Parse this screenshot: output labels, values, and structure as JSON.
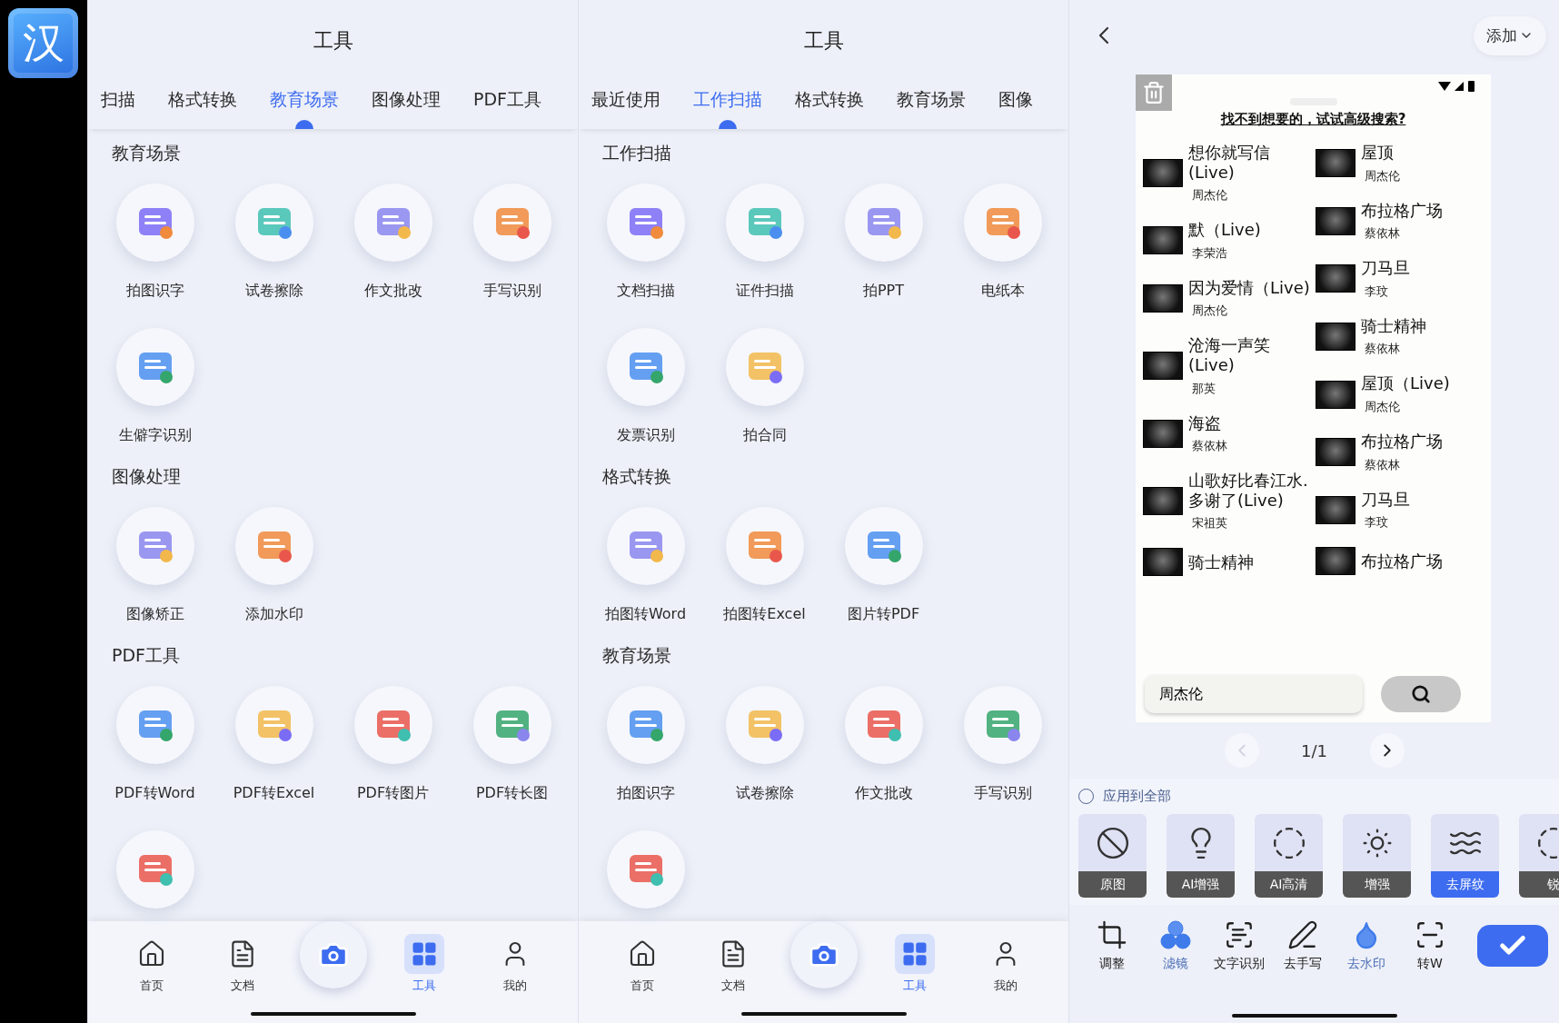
{
  "app_icon": {
    "label": "汉"
  },
  "panels": [
    {
      "title": "工具",
      "tabs": [
        {
          "label": "扫描",
          "selected": false
        },
        {
          "label": "格式转换",
          "selected": false
        },
        {
          "label": "教育场景",
          "selected": true
        },
        {
          "label": "图像处理",
          "selected": false
        },
        {
          "label": "PDF工具",
          "selected": false
        }
      ],
      "sections": [
        {
          "title": "教育场景",
          "partial_tile": false,
          "tools": [
            "拍图识字",
            "试卷擦除",
            "作文批改",
            "手写识别",
            "生僻字识别"
          ]
        },
        {
          "title": "图像处理",
          "partial_tile": false,
          "tools": [
            "图像矫正",
            "添加水印"
          ]
        },
        {
          "title": "PDF工具",
          "partial_tile": true,
          "tools": [
            "PDF转Word",
            "PDF转Excel",
            "PDF转图片",
            "PDF转长图"
          ]
        }
      ],
      "nav": [
        {
          "kind": "home",
          "label": "首页",
          "selected": false
        },
        {
          "kind": "docs",
          "label": "文档",
          "selected": false
        },
        {
          "kind": "camera"
        },
        {
          "kind": "tools",
          "label": "工具",
          "selected": true
        },
        {
          "kind": "profile",
          "label": "我的",
          "selected": false
        }
      ]
    },
    {
      "title": "工具",
      "tabs": [
        {
          "label": "最近使用",
          "selected": false
        },
        {
          "label": "工作扫描",
          "selected": true
        },
        {
          "label": "格式转换",
          "selected": false
        },
        {
          "label": "教育场景",
          "selected": false
        },
        {
          "label": "图像",
          "selected": false
        }
      ],
      "sections": [
        {
          "title": "工作扫描",
          "partial_tile": false,
          "tools": [
            "文档扫描",
            "证件扫描",
            "拍PPT",
            "电纸本",
            "发票识别",
            "拍合同"
          ]
        },
        {
          "title": "格式转换",
          "partial_tile": false,
          "tools": [
            "拍图转Word",
            "拍图转Excel",
            "图片转PDF"
          ]
        },
        {
          "title": "教育场景",
          "partial_tile": true,
          "tools": [
            "拍图识字",
            "试卷擦除",
            "作文批改",
            "手写识别"
          ]
        }
      ],
      "nav": [
        {
          "kind": "home",
          "label": "首页",
          "selected": false
        },
        {
          "kind": "docs",
          "label": "文档",
          "selected": false
        },
        {
          "kind": "camera"
        },
        {
          "kind": "tools",
          "label": "工具",
          "selected": true
        },
        {
          "kind": "profile",
          "label": "我的",
          "selected": false
        }
      ]
    }
  ],
  "editor": {
    "add_button": "添加",
    "screenshot": {
      "link": "找不到想要的，试试高级搜索?",
      "song_columns": [
        {
          "songs": [
            {
              "title": "想你就写信(Live)",
              "artist": "周杰伦"
            },
            {
              "title": "默（Live)",
              "artist": "李荣浩"
            },
            {
              "title": "因为爱情（Live)",
              "artist": "周杰伦"
            },
            {
              "title": "沧海一声笑(Live)",
              "artist": "那英"
            },
            {
              "title": "海盗",
              "artist": "蔡依林"
            },
            {
              "title": "山歌好比春江水.多谢了(Live)",
              "artist": "宋祖英"
            },
            {
              "title": "骑士精神"
            }
          ]
        },
        {
          "songs": [
            {
              "title": "屋顶",
              "artist": "周杰伦"
            },
            {
              "title": "布拉格广场",
              "artist": "蔡依林"
            },
            {
              "title": "刀马旦",
              "artist": "李玟"
            },
            {
              "title": "骑士精神",
              "artist": "蔡依林"
            },
            {
              "title": "屋顶（Live)",
              "artist": "周杰伦"
            },
            {
              "title": "布拉格广场",
              "artist": "蔡依林"
            },
            {
              "title": "刀马旦",
              "artist": "李玟"
            },
            {
              "title": "布拉格广场"
            }
          ]
        }
      ],
      "search_value": "周杰伦"
    },
    "pager": {
      "label": "1/1",
      "prev_disabled": true,
      "next_disabled": false
    },
    "apply_all": {
      "label": "应用到全部",
      "checked": false
    },
    "filters": [
      {
        "label": "原图",
        "selected": false
      },
      {
        "label": "AI增强",
        "selected": false
      },
      {
        "label": "AI高清",
        "selected": false
      },
      {
        "label": "增强",
        "selected": false
      },
      {
        "label": "去屏纹",
        "selected": true
      },
      {
        "label": "锐",
        "selected": false
      }
    ],
    "tools": [
      {
        "label": "调整",
        "active": false
      },
      {
        "label": "滤镜",
        "active": true
      },
      {
        "label": "文字识别",
        "active": false
      },
      {
        "label": "去手写",
        "active": false
      },
      {
        "label": "去水印",
        "active": true
      },
      {
        "label": "转W",
        "active": false
      }
    ]
  }
}
